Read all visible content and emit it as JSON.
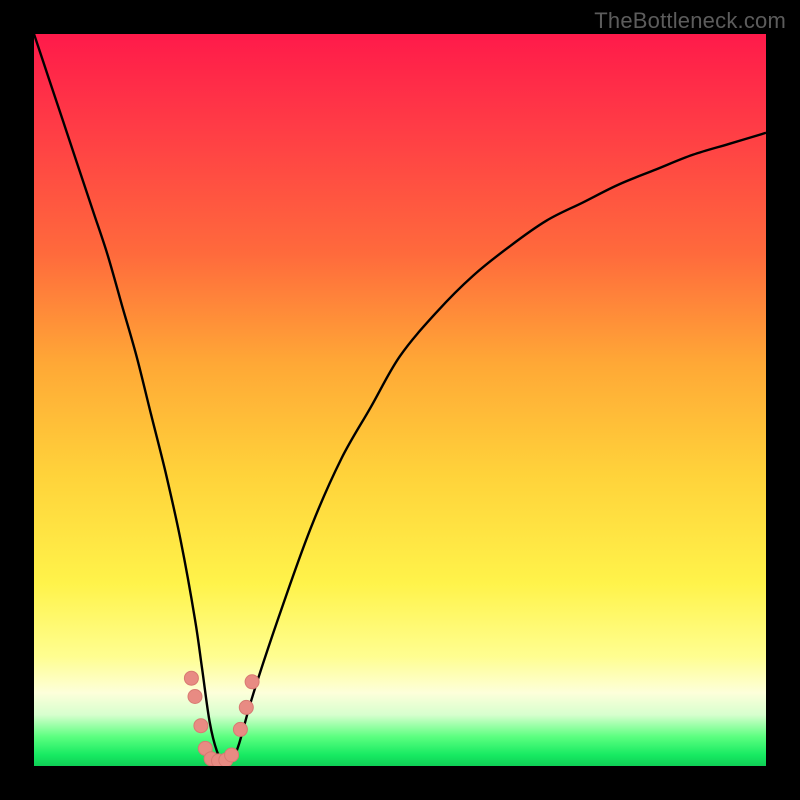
{
  "watermark": "TheBottleneck.com",
  "colors": {
    "frame": "#000000",
    "curve": "#000000",
    "marker_fill": "#e88b83",
    "marker_stroke": "#d87a72"
  },
  "chart_data": {
    "type": "line",
    "title": "",
    "xlabel": "",
    "ylabel": "",
    "xlim": [
      0,
      100
    ],
    "ylim": [
      0,
      100
    ],
    "series": [
      {
        "name": "bottleneck-curve",
        "x": [
          0,
          2,
          4,
          6,
          8,
          10,
          12,
          14,
          16,
          18,
          20,
          22,
          23,
          24,
          25,
          26,
          27,
          28,
          30,
          34,
          38,
          42,
          46,
          50,
          55,
          60,
          65,
          70,
          75,
          80,
          85,
          90,
          95,
          100
        ],
        "y": [
          100,
          94,
          88,
          82,
          76,
          70,
          63,
          56,
          48,
          40,
          31,
          20,
          13,
          6,
          2,
          0.5,
          0.7,
          3,
          10,
          22,
          33,
          42,
          49,
          56,
          62,
          67,
          71,
          74.5,
          77,
          79.5,
          81.5,
          83.5,
          85,
          86.5
        ]
      }
    ],
    "markers": [
      {
        "x": 21.5,
        "y": 12.0
      },
      {
        "x": 22.0,
        "y": 9.5
      },
      {
        "x": 22.8,
        "y": 5.5
      },
      {
        "x": 23.4,
        "y": 2.4
      },
      {
        "x": 24.2,
        "y": 1.0
      },
      {
        "x": 25.2,
        "y": 0.7
      },
      {
        "x": 26.2,
        "y": 0.8
      },
      {
        "x": 27.0,
        "y": 1.5
      },
      {
        "x": 28.2,
        "y": 5.0
      },
      {
        "x": 29.0,
        "y": 8.0
      },
      {
        "x": 29.8,
        "y": 11.5
      }
    ],
    "gradient_stops_pct_from_top": {
      "red": 0,
      "orange": 40,
      "yellow": 75,
      "pale": 90,
      "green": 100
    }
  }
}
